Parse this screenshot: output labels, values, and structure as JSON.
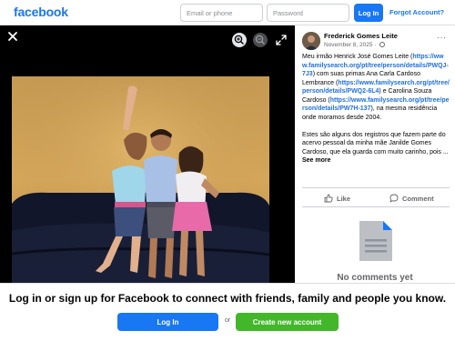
{
  "header": {
    "logo_text": "facebook",
    "email_placeholder": "Email or phone",
    "password_placeholder": "Password",
    "login_label": "Log In",
    "forgot_label": "Forgot Account?"
  },
  "viewer": {
    "close_icon": "close-icon",
    "zoom_in_icon": "zoom-in-icon",
    "zoom_out_icon": "zoom-out-icon",
    "expand_icon": "expand-icon"
  },
  "post": {
    "author": "Frederick Gomes Leite",
    "date": "November 8, 2025",
    "privacy_icon": "globe-icon",
    "more_label": "···",
    "text_1": "Meu irmão Henrick José Gomes Leite (",
    "link_1": "https://www.familysearch.org/pt/tree/person/details/PWQJ-7J3",
    "text_2": ") com suas primas Ana Carla Cardoso Lembrance (",
    "link_2": "https://www.familysearch.org/pt/tree/person/details/PWQ2-6L4",
    "text_3": ") e Carolina Souza Cardoso (",
    "link_3": "https://www.familysearch.org/pt/tree/person/details/PW7H-137",
    "text_4": "), na mesma residência onde moramos desde 2004.",
    "paragraph_2": "Estes são alguns dos registros que fazem parte do acervo pessoal da minha mãe Janilde Gomes Cardoso, que ela guarda com muito carinho, pois ... ",
    "see_more": "See more"
  },
  "actions": {
    "like_label": "Like",
    "comment_label": "Comment"
  },
  "comments": {
    "empty_label": "No comments yet"
  },
  "banner": {
    "text": "Log in or sign up for Facebook to connect with friends, family and people you know.",
    "login_label": "Log In",
    "or_label": "or",
    "create_label": "Create new account"
  },
  "colors": {
    "brand": "#1877f2",
    "create_green": "#42b72a",
    "link": "#216fdb"
  }
}
